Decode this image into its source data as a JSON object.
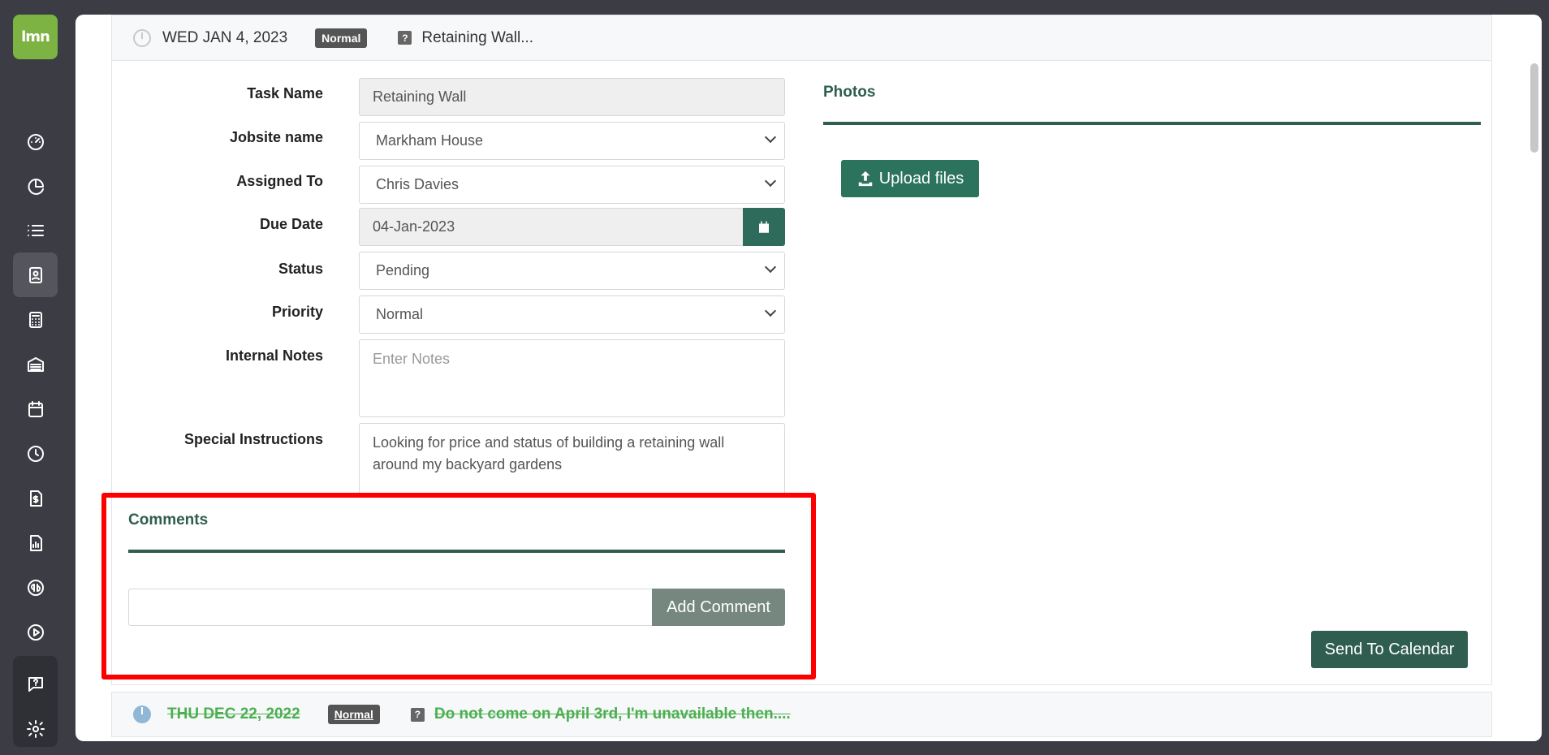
{
  "app": {
    "logo_text": "lmn"
  },
  "sidebar": {
    "items": [
      {
        "icon": "dashboard-icon"
      },
      {
        "icon": "pie-chart-icon"
      },
      {
        "icon": "list-icon"
      },
      {
        "icon": "contact-card-icon",
        "active": true
      },
      {
        "icon": "calculator-icon"
      },
      {
        "icon": "warehouse-icon"
      },
      {
        "icon": "calendar-icon"
      },
      {
        "icon": "clock-icon"
      },
      {
        "icon": "invoice-icon"
      },
      {
        "icon": "report-icon"
      },
      {
        "icon": "quickbooks-icon"
      },
      {
        "icon": "play-icon"
      },
      {
        "icon": "help-chat-icon"
      },
      {
        "icon": "settings-icon"
      }
    ]
  },
  "task": {
    "header_date": "WED JAN 4, 2023",
    "header_badge": "Normal",
    "header_title": "Retaining Wall...",
    "fields": {
      "task_name_label": "Task Name",
      "task_name_value": "Retaining Wall",
      "jobsite_label": "Jobsite name",
      "jobsite_value": "Markham House",
      "assigned_label": "Assigned To",
      "assigned_value": "Chris Davies",
      "due_label": "Due Date",
      "due_value": "04-Jan-2023",
      "status_label": "Status",
      "status_value": "Pending",
      "priority_label": "Priority",
      "priority_value": "Normal",
      "notes_label": "Internal Notes",
      "notes_placeholder": "Enter Notes",
      "instructions_label": "Special Instructions",
      "instructions_value": "Looking for price and status of building a retaining wall around my backyard gardens"
    },
    "photos_title": "Photos",
    "upload_label": "Upload files",
    "comments_title": "Comments",
    "add_comment_label": "Add Comment",
    "send_calendar_label": "Send To Calendar"
  },
  "task2": {
    "header_date": "THU DEC 22, 2022",
    "header_badge": "Normal",
    "header_title": "Do not come on April 3rd, I'm unavailable then...."
  },
  "colors": {
    "accent": "#2f5d50",
    "brand": "#7cb342",
    "highlight": "#ff0000",
    "done": "#4caf50"
  }
}
